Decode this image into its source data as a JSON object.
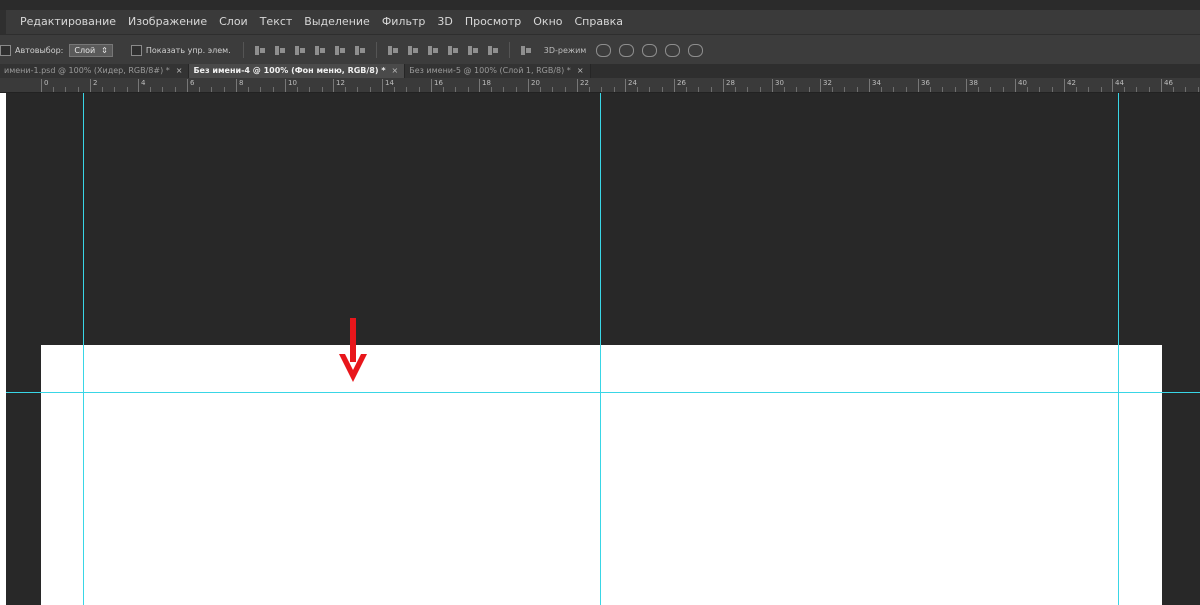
{
  "menu": {
    "items": [
      "Редактирование",
      "Изображение",
      "Слои",
      "Текст",
      "Выделение",
      "Фильтр",
      "3D",
      "Просмотр",
      "Окно",
      "Справка"
    ]
  },
  "options": {
    "autoselect_label": "Автовыбор:",
    "autoselect_value": "Слой",
    "show_controls_label": "Показать упр. элем.",
    "mode_3d_label": "3D-режим"
  },
  "tabs": [
    {
      "label": "имени-1.psd @ 100% (Хидер, RGB/8#) *",
      "close": "×",
      "active": false
    },
    {
      "label": "Без имени-4 @ 100% (Фон меню, RGB/8) *",
      "close": "×",
      "active": true
    },
    {
      "label": "Без имени-5 @ 100% (Слой 1, RGB/8) *",
      "close": "×",
      "active": false
    }
  ],
  "ruler": {
    "labels": [
      "0",
      "2",
      "4",
      "6",
      "8",
      "10",
      "12",
      "14",
      "16",
      "18",
      "20",
      "22",
      "24",
      "26",
      "28",
      "30",
      "32",
      "34",
      "36",
      "38",
      "40",
      "42",
      "44",
      "46"
    ]
  },
  "colors": {
    "guide": "#39d6e6",
    "arrow": "#e8161b",
    "workspace": "#282828",
    "document": "#ffffff"
  },
  "icons": {
    "annotation": "red-down-arrow-icon"
  }
}
